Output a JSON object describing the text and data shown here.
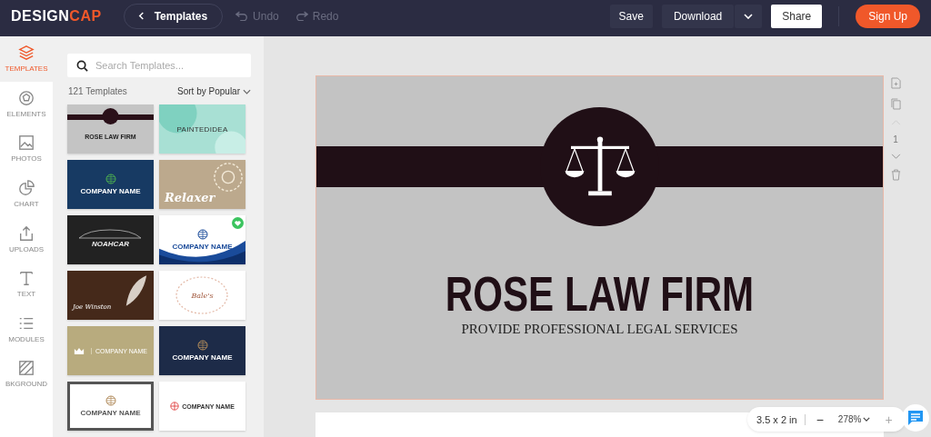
{
  "topbar": {
    "logo": {
      "first": "DESIGN",
      "second": "CAP"
    },
    "back_button": "Templates",
    "undo": {
      "label": "Undo",
      "disabled": true
    },
    "redo": {
      "label": "Redo",
      "disabled": true
    },
    "save": "Save",
    "download": "Download",
    "share": "Share",
    "signup": "Sign Up"
  },
  "rail": [
    {
      "label": "TEMPLATES",
      "selected": true
    },
    {
      "label": "ELEMENTS",
      "selected": false
    },
    {
      "label": "PHOTOS",
      "selected": false
    },
    {
      "label": "CHART",
      "selected": false
    },
    {
      "label": "UPLOADS",
      "selected": false
    },
    {
      "label": "TEXT",
      "selected": false
    },
    {
      "label": "MODULES",
      "selected": false
    },
    {
      "label": "BKGROUND",
      "selected": false
    }
  ],
  "panel": {
    "search": {
      "placeholder": "Search Templates..."
    },
    "count": "121 Templates",
    "sort": "Sort by Popular",
    "templates": [
      {
        "kind": "law",
        "color": "#c4c4c4",
        "title": "ROSE LAW FIRM",
        "favorite": false
      },
      {
        "kind": "painted",
        "color": "#a8e0d4",
        "title": "PAINTEDIDEA",
        "favorite": false
      },
      {
        "kind": "globe",
        "color": "#173a63",
        "title": "COMPANY NAME",
        "favorite": false
      },
      {
        "kind": "script",
        "color": "#bca98d",
        "title": "Relaxer",
        "favorite": false
      },
      {
        "kind": "car",
        "color": "#222222",
        "title": "NOAHCAR",
        "favorite": false
      },
      {
        "kind": "wave",
        "color": "#ffffff",
        "title": "COMPANY NAME",
        "favorite": true
      },
      {
        "kind": "feather",
        "color": "#45291a",
        "title": "Joe Winston",
        "favorite": false
      },
      {
        "kind": "floral",
        "color": "#ffffff",
        "title": "Bale's",
        "favorite": false
      },
      {
        "kind": "crown",
        "color": "#b8ab7e",
        "title": "COMPANY NAME",
        "favorite": false
      },
      {
        "kind": "globe",
        "color": "#1d2b48",
        "title": "COMPANY NAME",
        "favorite": false
      },
      {
        "kind": "frame",
        "color": "#ffffff",
        "title": "COMPANY NAME",
        "favorite": false
      },
      {
        "kind": "red-globe",
        "color": "#ffffff",
        "title": "COMPANY NAME",
        "favorite": false
      }
    ]
  },
  "canvas": {
    "title": "ROSE LAW FIRM",
    "subtitle": "PROVIDE PROFESSIONAL LEGAL SERVICES",
    "page_number": "1",
    "size": "3.5 x 2 in",
    "zoom": "278%",
    "zoom_out": "−",
    "zoom_in": "+"
  }
}
